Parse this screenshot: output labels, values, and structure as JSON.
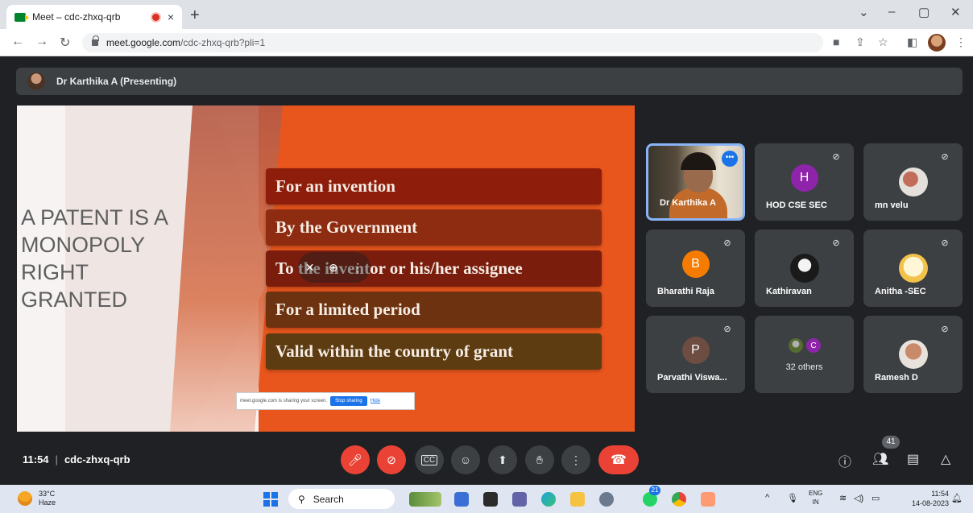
{
  "browser": {
    "tab_title": "Meet – cdc-zhxq-qrb",
    "tab_close": "×",
    "new_tab": "+",
    "url_host": "meet.google.com",
    "url_path": "/cdc-zhxq-qrb?pli=1"
  },
  "presenter_bar": {
    "label": "Dr Karthika A (Presenting)"
  },
  "slide": {
    "heading_lines": [
      "A PATENT IS A",
      "MONOPOLY",
      "RIGHT",
      "GRANTED"
    ],
    "points": [
      "For an invention",
      "By the Government",
      "To the inventor or his/her assignee",
      "For a limited period",
      "Valid within the country of grant"
    ],
    "share_notice": "meet.google.com is sharing your screen.",
    "stop_sharing": "Stop sharing",
    "hide": "Hide",
    "colors": {
      "background": "#e9561d",
      "point_1": "#8e1d0b",
      "point_2": "#8d2c10",
      "point_3": "#7a1d0d",
      "point_4": "#6d3210",
      "point_5": "#5e3c12"
    }
  },
  "participants": [
    {
      "name": "Dr Karthika A",
      "type": "video",
      "active": true
    },
    {
      "name": "HOD CSE SEC",
      "type": "letter",
      "letter": "H",
      "color": "#8e24aa"
    },
    {
      "name": "mn velu",
      "type": "photo"
    },
    {
      "name": "Bharathi Raja",
      "type": "letter",
      "letter": "B",
      "color": "#f57c00"
    },
    {
      "name": "Kathiravan",
      "type": "photo"
    },
    {
      "name": "Anitha -SEC",
      "type": "photo"
    },
    {
      "name": "Parvathi Viswa...",
      "type": "letter",
      "letter": "P",
      "color": "#6d4c41"
    },
    {
      "name": "32 others",
      "type": "others",
      "letter": "C"
    },
    {
      "name": "Ramesh D",
      "type": "photo"
    }
  ],
  "controls": {
    "time": "11:54",
    "meeting_code": "cdc-zhxq-qrb",
    "participant_count": "41"
  },
  "taskbar": {
    "temperature": "33°C",
    "weather": "Haze",
    "search": "Search",
    "lang_1": "ENG",
    "lang_2": "IN",
    "time": "11:54",
    "date": "14-08-2023",
    "badge": "21"
  }
}
